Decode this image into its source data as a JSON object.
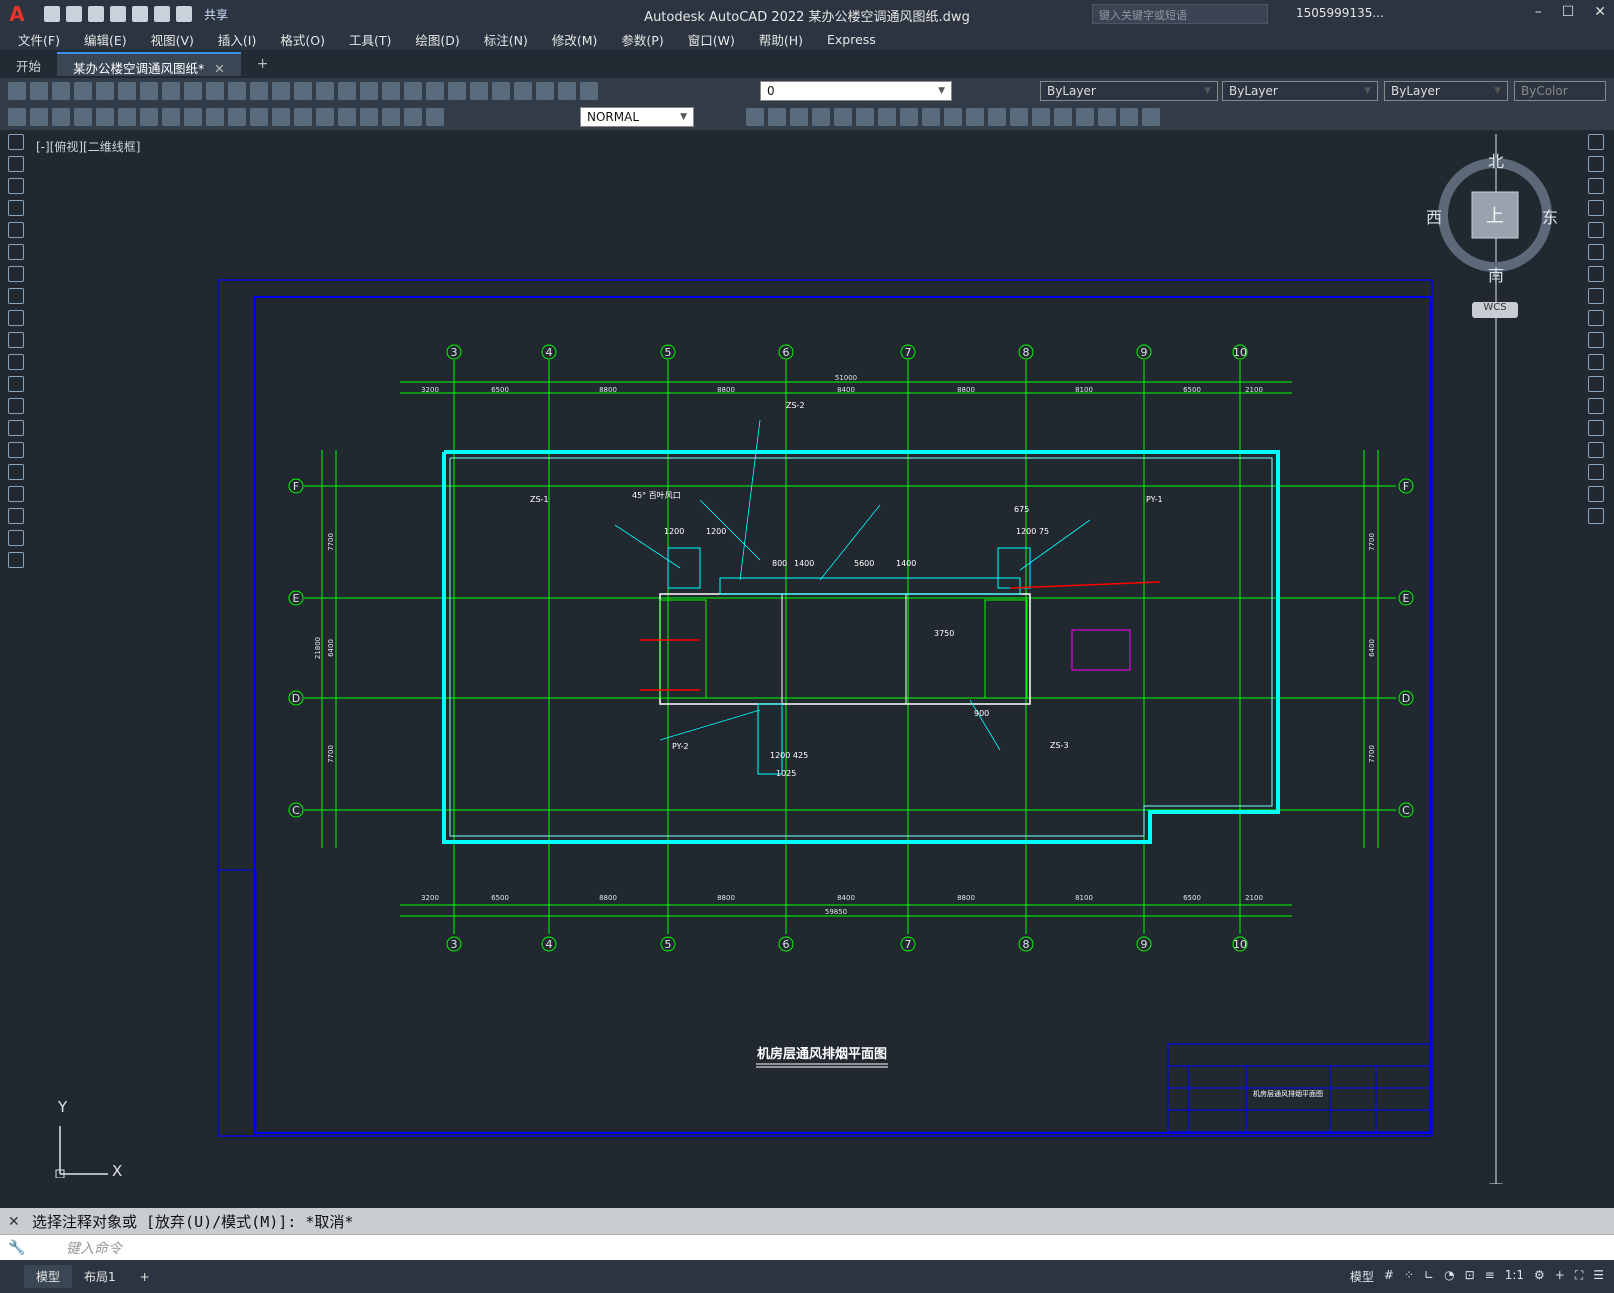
{
  "window": {
    "logo": "A",
    "title": "Autodesk AutoCAD 2022    某办公楼空调通风图纸.dwg",
    "search_placeholder": "键入关键字或短语",
    "user": "1505999135...",
    "share": "共享"
  },
  "menu": [
    "文件(F)",
    "编辑(E)",
    "视图(V)",
    "插入(I)",
    "格式(O)",
    "工具(T)",
    "绘图(D)",
    "标注(N)",
    "修改(M)",
    "参数(P)",
    "窗口(W)",
    "帮助(H)",
    "Express"
  ],
  "tabs": [
    {
      "label": "开始"
    },
    {
      "label": "某办公楼空调通风图纸*"
    }
  ],
  "toolbar": {
    "layer": "0",
    "color": "ByLayer",
    "linetype": "ByLayer",
    "lineweight": "ByLayer",
    "plotstyle": "ByColor",
    "dimstyle": "NORMAL"
  },
  "viewport": {
    "label": "[-][俯视][二维线框]"
  },
  "compass": {
    "north": "北",
    "south": "南",
    "east": "东",
    "west": "西",
    "top": "上",
    "wcs": "WCS"
  },
  "ucs": {
    "x": "X",
    "y": "Y"
  },
  "drawing": {
    "title": "机房层通风排烟平面图",
    "grid_top": [
      "3",
      "4",
      "5",
      "6",
      "7",
      "8",
      "9",
      "10"
    ],
    "grid_side": [
      "F",
      "E",
      "D",
      "C"
    ],
    "dims_top": [
      "3200",
      "6500",
      "8800",
      "8800",
      "8400",
      "8800",
      "8100",
      "6500",
      "2100"
    ],
    "overall_top": "51000",
    "overall_bottom": "59850",
    "side_dims": [
      "7700",
      "6400",
      "7700"
    ],
    "side_total": "21800",
    "notes": [
      "ZS-1",
      "ZS-2",
      "ZS-3",
      "PY-1",
      "PY-2",
      "1400",
      "5600",
      "1400",
      "800",
      "1200",
      "1200",
      "675",
      "1025",
      "900",
      "1200 425",
      "1200 75",
      "3750",
      "45° 百叶风口"
    ],
    "titleblock_name": "机房层通风排烟平面图"
  },
  "command": {
    "history": "选择注释对象或 [放弃(U)/模式(M)]: *取消*",
    "placeholder": "键入命令"
  },
  "status": {
    "tabs": [
      "模型",
      "布局1"
    ],
    "model": "模型",
    "scale": "1:1"
  },
  "colors": {
    "cad_bg": "#212830",
    "frame": "#0000ff",
    "grid": "#00ff00",
    "wall": "#00ffff",
    "text": "#00ffff"
  }
}
